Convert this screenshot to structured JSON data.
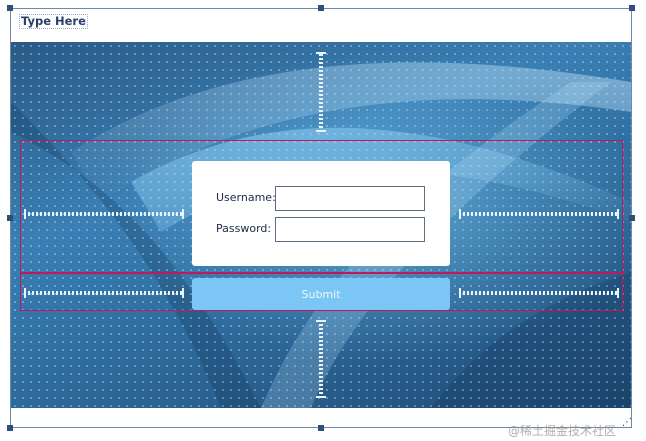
{
  "form": {
    "title": "Type Here"
  },
  "login": {
    "username_label": "Username:",
    "password_label": "Password:",
    "username_value": "",
    "password_value": ""
  },
  "submit": {
    "label": "Submit"
  },
  "watermark": "@稀土掘金技术社区",
  "colors": {
    "layout_border": "#c2185b",
    "submit_bg": "#7cc6f6",
    "handle": "#2d4f78",
    "title_text": "#2c3e6b"
  },
  "icons": {
    "resize_grip": "resize-grip-icon"
  }
}
